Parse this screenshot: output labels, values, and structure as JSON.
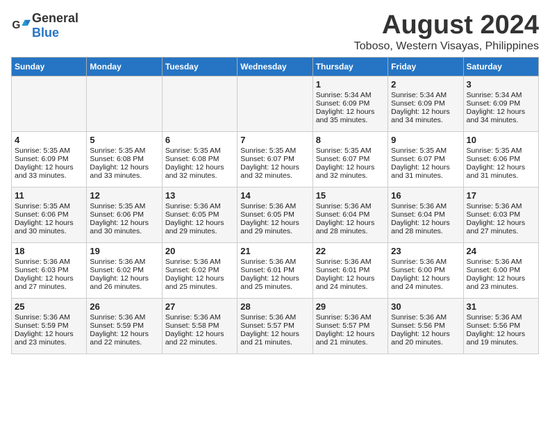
{
  "header": {
    "logo_general": "General",
    "logo_blue": "Blue",
    "title": "August 2024",
    "subtitle": "Toboso, Western Visayas, Philippines"
  },
  "days_of_week": [
    "Sunday",
    "Monday",
    "Tuesday",
    "Wednesday",
    "Thursday",
    "Friday",
    "Saturday"
  ],
  "weeks": [
    [
      {
        "day": "",
        "content": ""
      },
      {
        "day": "",
        "content": ""
      },
      {
        "day": "",
        "content": ""
      },
      {
        "day": "",
        "content": ""
      },
      {
        "day": "1",
        "content": "Sunrise: 5:34 AM\nSunset: 6:09 PM\nDaylight: 12 hours\nand 35 minutes."
      },
      {
        "day": "2",
        "content": "Sunrise: 5:34 AM\nSunset: 6:09 PM\nDaylight: 12 hours\nand 34 minutes."
      },
      {
        "day": "3",
        "content": "Sunrise: 5:34 AM\nSunset: 6:09 PM\nDaylight: 12 hours\nand 34 minutes."
      }
    ],
    [
      {
        "day": "4",
        "content": "Sunrise: 5:35 AM\nSunset: 6:09 PM\nDaylight: 12 hours\nand 33 minutes."
      },
      {
        "day": "5",
        "content": "Sunrise: 5:35 AM\nSunset: 6:08 PM\nDaylight: 12 hours\nand 33 minutes."
      },
      {
        "day": "6",
        "content": "Sunrise: 5:35 AM\nSunset: 6:08 PM\nDaylight: 12 hours\nand 32 minutes."
      },
      {
        "day": "7",
        "content": "Sunrise: 5:35 AM\nSunset: 6:07 PM\nDaylight: 12 hours\nand 32 minutes."
      },
      {
        "day": "8",
        "content": "Sunrise: 5:35 AM\nSunset: 6:07 PM\nDaylight: 12 hours\nand 32 minutes."
      },
      {
        "day": "9",
        "content": "Sunrise: 5:35 AM\nSunset: 6:07 PM\nDaylight: 12 hours\nand 31 minutes."
      },
      {
        "day": "10",
        "content": "Sunrise: 5:35 AM\nSunset: 6:06 PM\nDaylight: 12 hours\nand 31 minutes."
      }
    ],
    [
      {
        "day": "11",
        "content": "Sunrise: 5:35 AM\nSunset: 6:06 PM\nDaylight: 12 hours\nand 30 minutes."
      },
      {
        "day": "12",
        "content": "Sunrise: 5:35 AM\nSunset: 6:06 PM\nDaylight: 12 hours\nand 30 minutes."
      },
      {
        "day": "13",
        "content": "Sunrise: 5:36 AM\nSunset: 6:05 PM\nDaylight: 12 hours\nand 29 minutes."
      },
      {
        "day": "14",
        "content": "Sunrise: 5:36 AM\nSunset: 6:05 PM\nDaylight: 12 hours\nand 29 minutes."
      },
      {
        "day": "15",
        "content": "Sunrise: 5:36 AM\nSunset: 6:04 PM\nDaylight: 12 hours\nand 28 minutes."
      },
      {
        "day": "16",
        "content": "Sunrise: 5:36 AM\nSunset: 6:04 PM\nDaylight: 12 hours\nand 28 minutes."
      },
      {
        "day": "17",
        "content": "Sunrise: 5:36 AM\nSunset: 6:03 PM\nDaylight: 12 hours\nand 27 minutes."
      }
    ],
    [
      {
        "day": "18",
        "content": "Sunrise: 5:36 AM\nSunset: 6:03 PM\nDaylight: 12 hours\nand 27 minutes."
      },
      {
        "day": "19",
        "content": "Sunrise: 5:36 AM\nSunset: 6:02 PM\nDaylight: 12 hours\nand 26 minutes."
      },
      {
        "day": "20",
        "content": "Sunrise: 5:36 AM\nSunset: 6:02 PM\nDaylight: 12 hours\nand 25 minutes."
      },
      {
        "day": "21",
        "content": "Sunrise: 5:36 AM\nSunset: 6:01 PM\nDaylight: 12 hours\nand 25 minutes."
      },
      {
        "day": "22",
        "content": "Sunrise: 5:36 AM\nSunset: 6:01 PM\nDaylight: 12 hours\nand 24 minutes."
      },
      {
        "day": "23",
        "content": "Sunrise: 5:36 AM\nSunset: 6:00 PM\nDaylight: 12 hours\nand 24 minutes."
      },
      {
        "day": "24",
        "content": "Sunrise: 5:36 AM\nSunset: 6:00 PM\nDaylight: 12 hours\nand 23 minutes."
      }
    ],
    [
      {
        "day": "25",
        "content": "Sunrise: 5:36 AM\nSunset: 5:59 PM\nDaylight: 12 hours\nand 23 minutes."
      },
      {
        "day": "26",
        "content": "Sunrise: 5:36 AM\nSunset: 5:59 PM\nDaylight: 12 hours\nand 22 minutes."
      },
      {
        "day": "27",
        "content": "Sunrise: 5:36 AM\nSunset: 5:58 PM\nDaylight: 12 hours\nand 22 minutes."
      },
      {
        "day": "28",
        "content": "Sunrise: 5:36 AM\nSunset: 5:57 PM\nDaylight: 12 hours\nand 21 minutes."
      },
      {
        "day": "29",
        "content": "Sunrise: 5:36 AM\nSunset: 5:57 PM\nDaylight: 12 hours\nand 21 minutes."
      },
      {
        "day": "30",
        "content": "Sunrise: 5:36 AM\nSunset: 5:56 PM\nDaylight: 12 hours\nand 20 minutes."
      },
      {
        "day": "31",
        "content": "Sunrise: 5:36 AM\nSunset: 5:56 PM\nDaylight: 12 hours\nand 19 minutes."
      }
    ]
  ]
}
